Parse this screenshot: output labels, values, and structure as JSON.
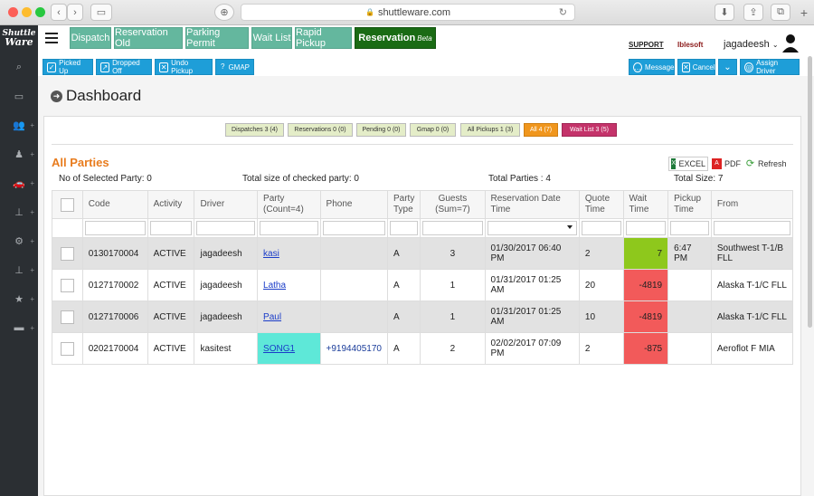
{
  "browser": {
    "url": "shuttleware.com"
  },
  "brand": {
    "logo_line1": "Shuttle",
    "logo_line2": "Ware"
  },
  "nav_tabs": [
    {
      "label": "Dispatch"
    },
    {
      "label": "Reservation Old"
    },
    {
      "label": "Parking Permit"
    },
    {
      "label": "Wait List"
    },
    {
      "label": "Rapid Pickup"
    },
    {
      "label": "Reservation",
      "sup": "Beta"
    }
  ],
  "header": {
    "support": "SUPPORT",
    "company": "Iblesoft",
    "user": "jagadeesh"
  },
  "actions_left": [
    {
      "label": "Picked Up"
    },
    {
      "label": "Dropped Off"
    },
    {
      "label": "Undo Pickup"
    },
    {
      "label": "GMAP"
    }
  ],
  "actions_right": [
    {
      "label": "Message"
    },
    {
      "label": "Cancel"
    },
    {
      "label": "Assign Driver"
    }
  ],
  "page": {
    "title": "Dashboard"
  },
  "filters": [
    {
      "label": "Dispatches 3 (4)"
    },
    {
      "label": "Reservations 0 (0)"
    },
    {
      "label": "Pending 0 (0)"
    },
    {
      "label": "Gmap 0 (0)"
    },
    {
      "label": "All Pickups 1 (3)"
    },
    {
      "label": "All 4 (7)"
    },
    {
      "label": "Wait List 3 (5)"
    }
  ],
  "parties": {
    "title": "All Parties",
    "selected": "No of Selected Party: 0",
    "checked_size": "Total size of checked party: 0",
    "total_parties": "Total Parties : 4",
    "total_size": "Total Size: 7",
    "export": {
      "excel": "EXCEL",
      "pdf": "PDF",
      "refresh": "Refresh"
    }
  },
  "table": {
    "columns": [
      "",
      "Code",
      "Activity",
      "Driver",
      "Party (Count=4)",
      "Phone",
      "Party Type",
      "Guests (Sum=7)",
      "Reservation Date Time",
      "Quote Time",
      "Wait Time",
      "Pickup Time",
      "From"
    ],
    "rows": [
      {
        "code": "0130170004",
        "activity": "ACTIVE",
        "driver": "jagadeesh",
        "party": "kasi",
        "phone": "",
        "type": "A",
        "guests": "3",
        "date": "01/30/2017 06:40 PM",
        "quote": "2",
        "wait": "7",
        "pickup": "6:47 PM",
        "from": "Southwest T-1/B FLL"
      },
      {
        "code": "0127170002",
        "activity": "ACTIVE",
        "driver": "jagadeesh",
        "party": "Latha",
        "phone": "",
        "type": "A",
        "guests": "1",
        "date": "01/31/2017 01:25 AM",
        "quote": "20",
        "wait": "-4819",
        "pickup": "",
        "from": "Alaska T-1/C FLL"
      },
      {
        "code": "0127170006",
        "activity": "ACTIVE",
        "driver": "jagadeesh",
        "party": "Paul",
        "phone": "",
        "type": "A",
        "guests": "1",
        "date": "01/31/2017 01:25 AM",
        "quote": "10",
        "wait": "-4819",
        "pickup": "",
        "from": "Alaska T-1/C FLL"
      },
      {
        "code": "0202170004",
        "activity": "ACTIVE",
        "driver": "kasitest",
        "party": "SONG1",
        "phone": "+9194405170",
        "type": "A",
        "guests": "2",
        "date": "02/02/2017 07:09 PM",
        "quote": "2",
        "wait": "-875",
        "pickup": "",
        "from": "Aeroflot F MIA"
      }
    ]
  }
}
